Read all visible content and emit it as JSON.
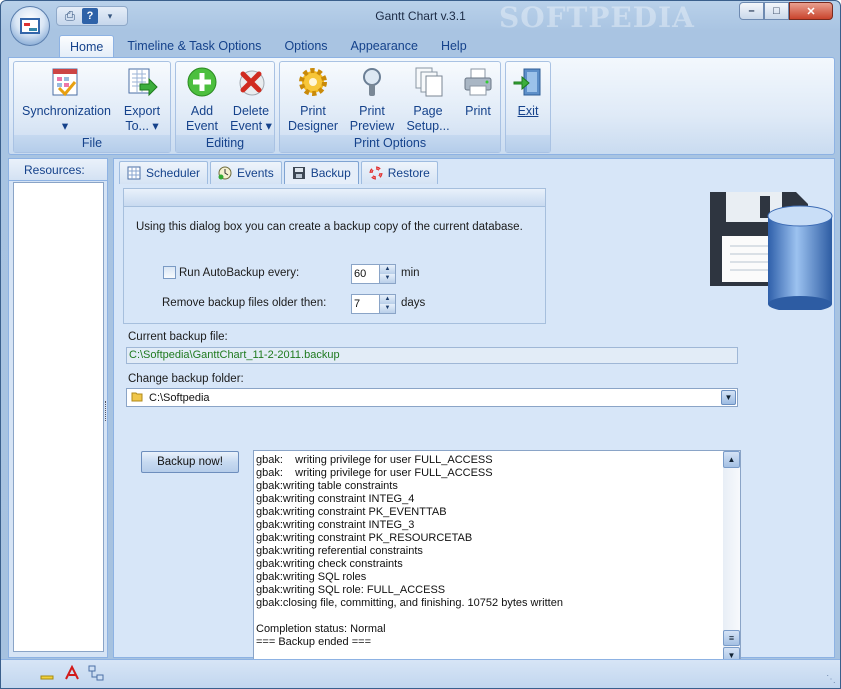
{
  "window": {
    "title": "Gantt Chart v.3.1",
    "watermark": "SOFTPEDIA"
  },
  "quick_access": {
    "icons": [
      "printer-icon",
      "help-icon",
      "dropdown-icon"
    ]
  },
  "ribbon": {
    "tabs": [
      "Home",
      "Timeline & Task Options",
      "Options",
      "Appearance",
      "Help"
    ],
    "active_tab": "Home",
    "groups": {
      "file": {
        "label": "File",
        "synchronization": [
          "Synchronization",
          "▾"
        ],
        "export": [
          "Export",
          "To... ▾"
        ]
      },
      "editing": {
        "label": "Editing",
        "add_event": [
          "Add",
          "Event"
        ],
        "delete_event": [
          "Delete",
          "Event ▾"
        ]
      },
      "print_options": {
        "label": "Print Options",
        "print_designer": [
          "Print",
          "Designer"
        ],
        "print_preview": [
          "Print",
          "Preview"
        ],
        "page_setup": [
          "Page",
          "Setup..."
        ],
        "print": [
          "Print"
        ]
      },
      "exit": {
        "label": "",
        "exit": [
          "Exit"
        ]
      }
    }
  },
  "resources": {
    "label": "Resources:"
  },
  "subtabs": [
    "Scheduler",
    "Events",
    "Backup",
    "Restore"
  ],
  "active_subtab": "Backup",
  "backup": {
    "intro": "Using this dialog box you can create a backup copy of the current database.",
    "autobackup_label": "Run AutoBackup every:",
    "autobackup_checked": false,
    "autobackup_value": "60",
    "autobackup_unit": "min",
    "remove_label": "Remove backup files older then:",
    "remove_value": "7",
    "remove_unit": "days",
    "current_file_label": "Current backup file:",
    "current_file": "C:\\Softpedia\\GanttChart_11-2-2011.backup",
    "change_folder_label": "Change backup folder:",
    "folder": "C:\\Softpedia",
    "backup_button": "Backup now!",
    "log": [
      "gbak:    writing privilege for user FULL_ACCESS",
      "gbak:    writing privilege for user FULL_ACCESS",
      "gbak:writing table constraints",
      "gbak:writing constraint INTEG_4",
      "gbak:writing constraint PK_EVENTTAB",
      "gbak:writing constraint INTEG_3",
      "gbak:writing constraint PK_RESOURCETAB",
      "gbak:writing referential constraints",
      "gbak:writing check constraints",
      "gbak:writing SQL roles",
      "gbak:writing SQL role: FULL_ACCESS",
      "gbak:closing file, committing, and finishing. 10752 bytes written",
      "",
      "Completion status: Normal",
      "=== Backup ended ==="
    ]
  }
}
